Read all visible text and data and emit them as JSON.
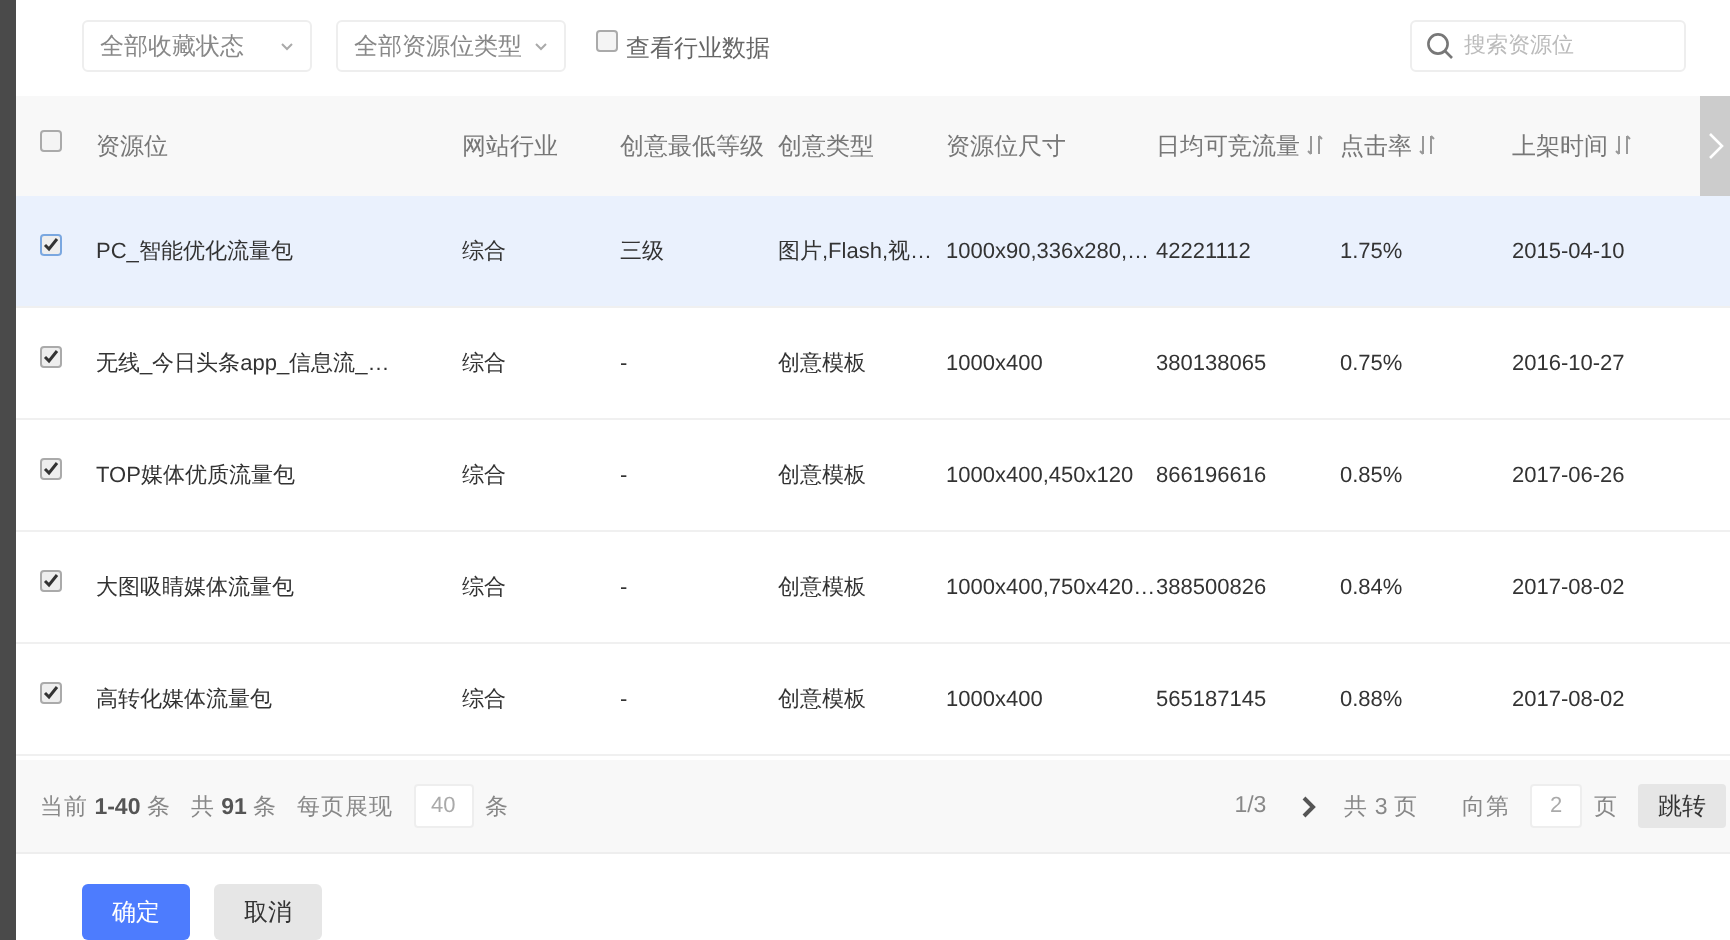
{
  "filters": {
    "dropdowns": [
      "全部收藏状态",
      "全部资源位类型"
    ],
    "industry_checkbox": {
      "label": "查看行业数据",
      "checked": false
    },
    "search": {
      "placeholder": "搜索资源位"
    }
  },
  "table": {
    "select_all": {
      "checked": false
    },
    "columns": [
      {
        "label": "资源位",
        "sortable": false
      },
      {
        "label": "网站行业",
        "sortable": false
      },
      {
        "label": "创意最低等级",
        "sortable": false
      },
      {
        "label": "创意类型",
        "sortable": false
      },
      {
        "label": "资源位尺寸",
        "sortable": false
      },
      {
        "label": "日均可竞流量",
        "sortable": true
      },
      {
        "label": "点击率",
        "sortable": true
      },
      {
        "label": "上架时间",
        "sortable": true
      }
    ],
    "rows": [
      {
        "selected": true,
        "checked": true,
        "cells": [
          "PC_智能优化流量包",
          "综合",
          "三级",
          "图片,Flash,视…",
          "1000x90,336x280,…",
          "42221112",
          "1.75%",
          "2015-04-10"
        ]
      },
      {
        "selected": false,
        "checked": true,
        "cells": [
          "无线_今日头条app_信息流_…",
          "综合",
          "-",
          "创意模板",
          "1000x400",
          "380138065",
          "0.75%",
          "2016-10-27"
        ]
      },
      {
        "selected": false,
        "checked": true,
        "cells": [
          "TOP媒体优质流量包",
          "综合",
          "-",
          "创意模板",
          "1000x400,450x120",
          "866196616",
          "0.85%",
          "2017-06-26"
        ]
      },
      {
        "selected": false,
        "checked": true,
        "cells": [
          "大图吸睛媒体流量包",
          "综合",
          "-",
          "创意模板",
          "1000x400,750x420…",
          "388500826",
          "0.84%",
          "2017-08-02"
        ]
      },
      {
        "selected": false,
        "checked": true,
        "cells": [
          "高转化媒体流量包",
          "综合",
          "-",
          "创意模板",
          "1000x400",
          "565187145",
          "0.88%",
          "2017-08-02"
        ]
      }
    ]
  },
  "pagination": {
    "current": "当前 **1-40** 条",
    "total": "共 **91** 条",
    "page_size_label": "每页展现",
    "page_size": "40",
    "page_size_unit": "条",
    "page": "1/3",
    "pages_total": "共 3 页",
    "goto_label": "向第",
    "goto_value": "2",
    "goto_unit": "页",
    "goto_button": "跳转"
  },
  "buttons": [
    {
      "label": "确定",
      "kind": "primary"
    },
    {
      "label": "取消",
      "kind": "secondary"
    }
  ]
}
